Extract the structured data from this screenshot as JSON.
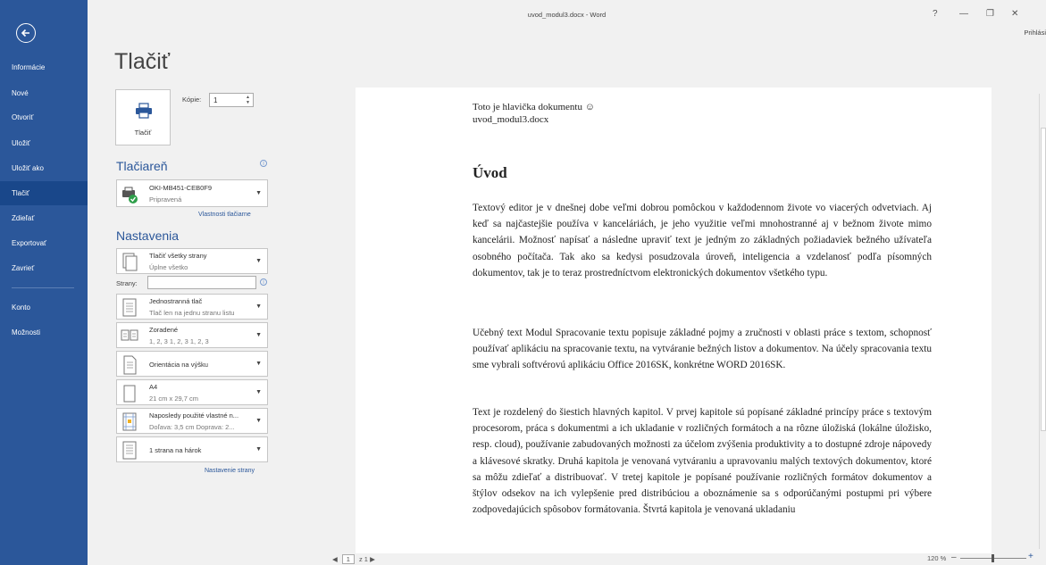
{
  "window": {
    "title": "uvod_modul3.docx - Word",
    "help": "?",
    "minimize": "—",
    "restore": "❐",
    "close": "✕",
    "signin": "Prihlási"
  },
  "sidebar": {
    "items": [
      {
        "label": "Informácie"
      },
      {
        "label": "Nové"
      },
      {
        "label": "Otvoriť"
      },
      {
        "label": "Uložiť"
      },
      {
        "label": "Uložiť ako"
      },
      {
        "label": "Tlačiť"
      },
      {
        "label": "Zdieľať"
      },
      {
        "label": "Exportovať"
      },
      {
        "label": "Zavrieť"
      },
      {
        "label": "Konto"
      },
      {
        "label": "Možnosti"
      }
    ],
    "active": "Tlačiť"
  },
  "print": {
    "heading": "Tlačiť",
    "button_label": "Tlačiť",
    "copies_label": "Kópie:",
    "copies_value": "1"
  },
  "printer": {
    "section_title": "Tlačiareň",
    "name": "OKI-MB451-CEB0F9",
    "status": "Pripravená",
    "properties_link": "Vlastnosti tlačiarne"
  },
  "settings": {
    "section_title": "Nastavenia",
    "pages_label": "Strany:",
    "page_setup_link": "Nastavenie strany",
    "dropdowns": [
      {
        "line1": "Tlačiť všetky strany",
        "line2": "Úplne všetko"
      },
      {
        "line1": "Jednostranná tlač",
        "line2": "Tlač len na jednu stranu listu"
      },
      {
        "line1": "Zoradené",
        "line2": "1, 2, 3   1, 2, 3   1, 2, 3"
      },
      {
        "line1": "Orientácia na výšku",
        "line2": ""
      },
      {
        "line1": "A4",
        "line2": "21 cm x 29,7 cm"
      },
      {
        "line1": "Naposledy použité vlastné n...",
        "line2": "Doľava: 3,5 cm   Doprava: 2..."
      },
      {
        "line1": "1 strana na hárok",
        "line2": ""
      }
    ]
  },
  "preview": {
    "header_line1": "Toto je hlavička dokumentu ☺",
    "header_line2": "uvod_modul3.docx",
    "heading": "Úvod",
    "paragraph1": "Textový editor je v dnešnej dobe veľmi dobrou pomôckou v každodennom živote vo viacerých odvetviach. Aj keď sa najčastejšie používa v kanceláriách, je jeho využitie veľmi mnohostranné aj v bežnom živote mimo kancelárii. Možnosť napísať a následne upraviť text je jedným zo základných požiadaviek bežného užívateľa osobného počítača. Tak ako sa kedysi posudzovala úroveň, inteligencia a vzdelanosť podľa písomných dokumentov, tak je to teraz prostredníctvom elektronických dokumentov všetkého typu.",
    "paragraph2": "Učebný text Modul Spracovanie textu popisuje základné pojmy a zručnosti v oblasti práce s textom, schopnosť používať aplikáciu na spracovanie textu, na vytváranie bežných listov a dokumentov. Na účely spracovania textu sme vybrali softvérovú aplikáciu Office 2016SK, konkrétne WORD 2016SK.",
    "paragraph3": "Text je rozdelený do šiestich hlavných kapitol. V prvej kapitole sú popísané základné princípy práce s textovým procesorom, práca s dokumentmi a ich ukladanie v rozličných formátoch a na rôzne úložiská (lokálne úložisko, resp. cloud), používanie zabudovaných možnosti za účelom zvýšenia produktivity a to dostupné zdroje nápovedy a klávesové skratky. Druhá kapitola je venovaná vytváraniu a upravovaniu malých textových dokumentov, ktoré sa môžu zdieľať a distribuovať. V tretej kapitole je popísané používanie rozličných formátov dokumentov a štýlov odsekov na ich vylepšenie pred distribúciou a oboznámenie sa s odporúčanými postupmi pri výbere zodpovedajúcich spôsobov formátovania. Štvrtá kapitola je venovaná ukladaniu"
  },
  "statusbar": {
    "prev": "◀",
    "page": "1",
    "of": "z 1",
    "next": "▶",
    "zoom": "120 %",
    "zoom_minus": "–",
    "zoom_plus": "+"
  }
}
